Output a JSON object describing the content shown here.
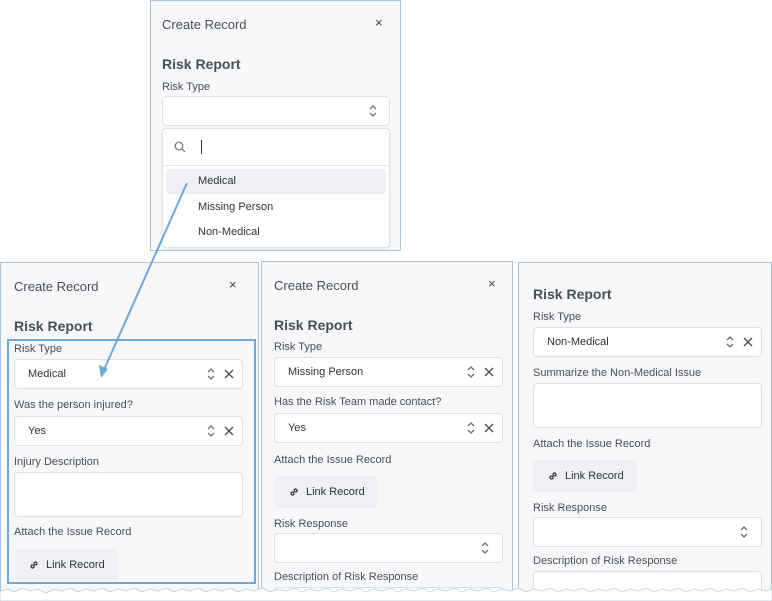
{
  "dialog_title": "Create Record",
  "form_heading": "Risk Report",
  "close_symbol": "×",
  "link_icon": "link-icon",
  "panel_top": {
    "risk_type_label": "Risk Type",
    "risk_type_value": "",
    "search_value": "",
    "options": [
      "Medical",
      "Missing Person",
      "Non-Medical"
    ],
    "highlighted_option": "Medical"
  },
  "panel_medical": {
    "risk_type_label": "Risk Type",
    "risk_type_value": "Medical",
    "injured_label": "Was the person injured?",
    "injured_value": "Yes",
    "injury_desc_label": "Injury Description",
    "attach_label": "Attach the Issue Record",
    "link_button": "Link Record"
  },
  "panel_missing": {
    "risk_type_label": "Risk Type",
    "risk_type_value": "Missing Person",
    "contact_label": "Has the Risk Team made contact?",
    "contact_value": "Yes",
    "attach_label": "Attach the Issue Record",
    "link_button": "Link Record",
    "response_label": "Risk Response",
    "response_value": "",
    "response_desc_label": "Description of Risk Response"
  },
  "panel_nonmedical": {
    "risk_type_label": "Risk Type",
    "risk_type_value": "Non-Medical",
    "summary_label": "Summarize the Non-Medical Issue",
    "attach_label": "Attach the Issue Record",
    "link_button": "Link Record",
    "response_label": "Risk Response",
    "response_value": "",
    "response_desc_label": "Description of Risk Response"
  },
  "colors": {
    "panel_border": "#a9c4e2",
    "panel_bg": "#f7f8fa",
    "highlight_border": "#6fa8dc",
    "arrow": "#6fa8dc"
  }
}
